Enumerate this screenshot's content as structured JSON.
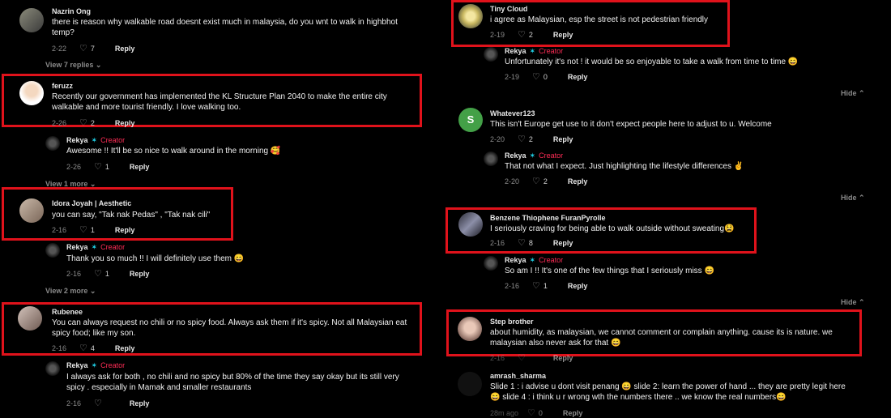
{
  "left": {
    "c1": {
      "user": "Nazrin Ong",
      "text": "there is reason why walkable road doesnt exist much in malaysia, do you wnt to walk in highbhot temp?",
      "date": "2-22",
      "likes": "7",
      "reply": "Reply"
    },
    "more1": "View 7 replies",
    "c2": {
      "user": "feruzz",
      "text": "Recently our government has implemented the KL Structure Plan 2040 to make the entire city walkable and more tourist friendly. I love walking too.",
      "date": "2-26",
      "likes": "2",
      "reply": "Reply"
    },
    "r2": {
      "user": "Rekya",
      "creator": "Creator",
      "text": "Awesome !! It'll be so nice to walk around in the morning 🥰",
      "date": "2-26",
      "likes": "1",
      "reply": "Reply"
    },
    "more2": "View 1 more",
    "c3": {
      "user": "Idora Joyah | Aesthetic",
      "text": "you can say, \"Tak nak Pedas\" , \"Tak nak cili\"",
      "date": "2-16",
      "likes": "1",
      "reply": "Reply"
    },
    "r3": {
      "user": "Rekya",
      "creator": "Creator",
      "text": "Thank you so much !! I will definitely use them 😄",
      "date": "2-16",
      "likes": "1",
      "reply": "Reply"
    },
    "more3": "View 2 more",
    "c4": {
      "user": "Rubenee",
      "text": "You can always request no chili or no spicy food. Always ask them if it's spicy. Not all Malaysian eat spicy food; like my son.",
      "date": "2-16",
      "likes": "4",
      "reply": "Reply"
    },
    "r4": {
      "user": "Rekya",
      "creator": "Creator",
      "text": "I always ask for both , no chili and no spicy but 80% of the time they say okay but its still very spicy . especially in Mamak and smaller restaurants",
      "date": "2-16",
      "likes": "",
      "reply": "Reply"
    }
  },
  "right": {
    "c1": {
      "user": "Tiny Cloud",
      "text": "i agree as Malaysian, esp the street is not pedestrian friendly",
      "date": "2-19",
      "likes": "2",
      "reply": "Reply"
    },
    "r1": {
      "user": "Rekya",
      "creator": "Creator",
      "text": "Unfortunately it's not ! it would be so enjoyable to take a walk from time to time 😄",
      "date": "2-19",
      "likes": "0",
      "reply": "Reply"
    },
    "hide1": "Hide",
    "c2": {
      "user": "Whatever123",
      "avatar_letter": "S",
      "text": "This isn't Europe get use to it don't expect people here to adjust to u. Welcome",
      "date": "2-20",
      "likes": "2",
      "reply": "Reply"
    },
    "r2": {
      "user": "Rekya",
      "creator": "Creator",
      "text": "That not what I expect. Just highlighting the lifestyle differences ✌",
      "date": "2-20",
      "likes": "2",
      "reply": "Reply"
    },
    "hide2": "Hide",
    "c3": {
      "user": "Benzene Thiophene FuranPyrolle",
      "text": "I seriously craving for being able to walk outside without sweating😫",
      "date": "2-16",
      "likes": "8",
      "reply": "Reply"
    },
    "r3": {
      "user": "Rekya",
      "creator": "Creator",
      "text": "So am I !! It's one of the few things that I seriously miss 😄",
      "date": "2-16",
      "likes": "1",
      "reply": "Reply"
    },
    "hide3": "Hide",
    "c4": {
      "user": "Step brother",
      "text": "about humidity, as malaysian, we cannot comment or complain anything. cause its is nature. we malaysian also never ask for that 😄",
      "date": "2-16",
      "likes": "",
      "reply": "Reply"
    },
    "c5": {
      "user": "amrash_sharma",
      "text": "Slide 1 : i advise u dont visit penang 😄 slide 2: learn the power of hand ... they are pretty legit here😄 slide 4 : i think u r wrong wth the numbers there .. we know the real numbers😄",
      "date": "28m ago",
      "likes": "0",
      "reply": "Reply"
    }
  },
  "colors": {
    "highlight": "#e0121b",
    "creator": "#fe2c55",
    "background": "#000000"
  }
}
